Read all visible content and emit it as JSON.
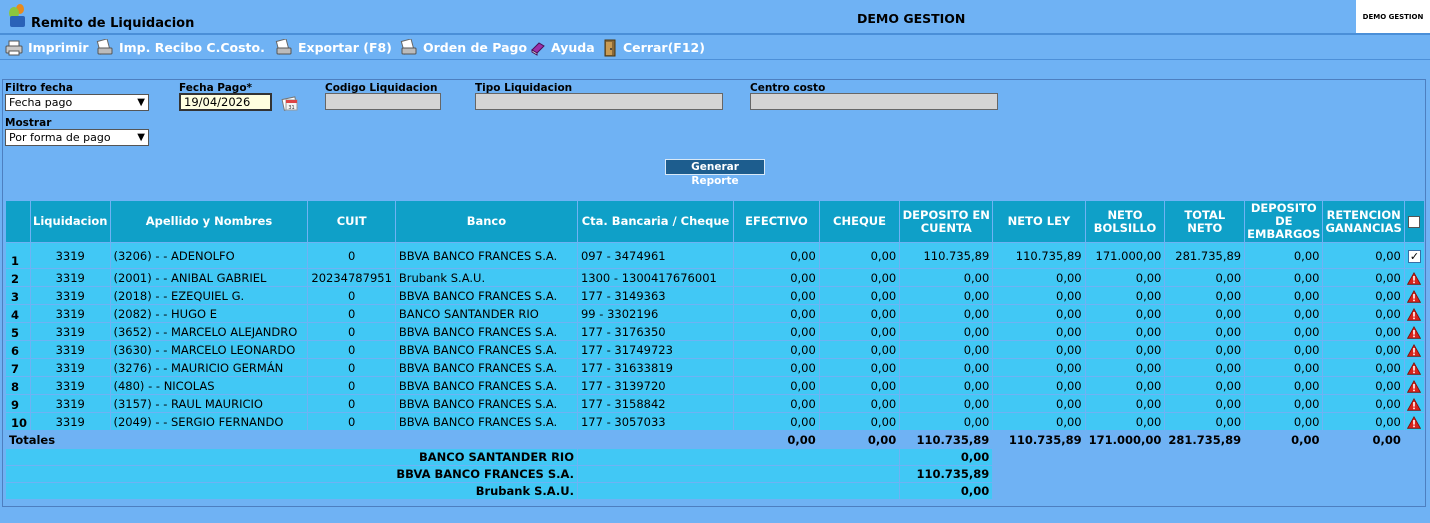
{
  "app": {
    "title": "Remito de Liquidacion",
    "company": "DEMO GESTION",
    "logo_text": "DEMO GESTION"
  },
  "toolbar": [
    {
      "label": "Imprimir",
      "icon": "printer-icon"
    },
    {
      "label": "Imp. Recibo C.Costo.",
      "icon": "print-receipt-icon"
    },
    {
      "label": "Exportar (F8)",
      "icon": "export-icon"
    },
    {
      "label": "Orden de Pago",
      "icon": "payment-order-icon"
    },
    {
      "label": "Ayuda",
      "icon": "help-book-icon"
    },
    {
      "label": "Cerrar(F12)",
      "icon": "close-door-icon"
    }
  ],
  "filters": {
    "filtro_fecha": {
      "label": "Filtro fecha",
      "value": "Fecha pago"
    },
    "fecha_pago": {
      "label": "Fecha Pago*",
      "value": "19/04/2026"
    },
    "codigo_liquidacion": {
      "label": "Codigo Liquidacion",
      "value": ""
    },
    "tipo_liquidacion": {
      "label": "Tipo Liquidacion",
      "value": ""
    },
    "centro_costo": {
      "label": "Centro costo",
      "value": ""
    },
    "mostrar": {
      "label": "Mostrar",
      "value": "Por forma de pago"
    }
  },
  "generate_button": "Generar Reporte",
  "table": {
    "headers": [
      "",
      "Liquidacion",
      "Apellido y Nombres",
      "CUIT",
      "Banco",
      "Cta. Bancaria / Cheque",
      "EFECTIVO",
      "CHEQUE",
      "DEPOSITO EN CUENTA",
      "NETO LEY",
      "NETO BOLSILLO",
      "TOTAL NETO",
      "DEPOSITO DE EMBARGOS",
      "RETENCION GANANCIAS"
    ],
    "rows": [
      {
        "n": "1",
        "liq": "3319",
        "nombre": "(3206) - - ADENOLFO",
        "cuit": "0",
        "banco": "BBVA BANCO FRANCES S.A.",
        "cta": "097 - 3474961",
        "efectivo": "0,00",
        "cheque": "0,00",
        "deposito": "110.735,89",
        "neto_ley": "110.735,89",
        "neto_bolsillo": "171.000,00",
        "total_neto": "281.735,89",
        "embargos": "0,00",
        "retencion": "0,00",
        "status": "checked"
      },
      {
        "n": "2",
        "liq": "3319",
        "nombre": "(2001) - - ANIBAL GABRIEL",
        "cuit": "20234787951",
        "banco": "Brubank S.A.U.",
        "cta": "1300 - 1300417676001",
        "efectivo": "0,00",
        "cheque": "0,00",
        "deposito": "0,00",
        "neto_ley": "0,00",
        "neto_bolsillo": "0,00",
        "total_neto": "0,00",
        "embargos": "0,00",
        "retencion": "0,00",
        "status": "warning"
      },
      {
        "n": "3",
        "liq": "3319",
        "nombre": "(2018) - - EZEQUIEL G.",
        "cuit": "0",
        "banco": "BBVA BANCO FRANCES S.A.",
        "cta": "177 - 3149363",
        "efectivo": "0,00",
        "cheque": "0,00",
        "deposito": "0,00",
        "neto_ley": "0,00",
        "neto_bolsillo": "0,00",
        "total_neto": "0,00",
        "embargos": "0,00",
        "retencion": "0,00",
        "status": "warning"
      },
      {
        "n": "4",
        "liq": "3319",
        "nombre": "(2082) - - HUGO E",
        "cuit": "0",
        "banco": "BANCO SANTANDER RIO",
        "cta": "99 - 3302196",
        "efectivo": "0,00",
        "cheque": "0,00",
        "deposito": "0,00",
        "neto_ley": "0,00",
        "neto_bolsillo": "0,00",
        "total_neto": "0,00",
        "embargos": "0,00",
        "retencion": "0,00",
        "status": "warning"
      },
      {
        "n": "5",
        "liq": "3319",
        "nombre": "(3652) - - MARCELO ALEJANDRO",
        "cuit": "0",
        "banco": "BBVA BANCO FRANCES S.A.",
        "cta": "177 - 3176350",
        "efectivo": "0,00",
        "cheque": "0,00",
        "deposito": "0,00",
        "neto_ley": "0,00",
        "neto_bolsillo": "0,00",
        "total_neto": "0,00",
        "embargos": "0,00",
        "retencion": "0,00",
        "status": "warning"
      },
      {
        "n": "6",
        "liq": "3319",
        "nombre": "(3630) - - MARCELO LEONARDO",
        "cuit": "0",
        "banco": "BBVA BANCO FRANCES S.A.",
        "cta": "177 - 31749723",
        "efectivo": "0,00",
        "cheque": "0,00",
        "deposito": "0,00",
        "neto_ley": "0,00",
        "neto_bolsillo": "0,00",
        "total_neto": "0,00",
        "embargos": "0,00",
        "retencion": "0,00",
        "status": "warning"
      },
      {
        "n": "7",
        "liq": "3319",
        "nombre": "(3276) - - MAURICIO GERMÁN",
        "cuit": "0",
        "banco": "BBVA BANCO FRANCES S.A.",
        "cta": "177 - 31633819",
        "efectivo": "0,00",
        "cheque": "0,00",
        "deposito": "0,00",
        "neto_ley": "0,00",
        "neto_bolsillo": "0,00",
        "total_neto": "0,00",
        "embargos": "0,00",
        "retencion": "0,00",
        "status": "warning"
      },
      {
        "n": "8",
        "liq": "3319",
        "nombre": "(480) - - NICOLAS",
        "cuit": "0",
        "banco": "BBVA BANCO FRANCES S.A.",
        "cta": "177 - 3139720",
        "efectivo": "0,00",
        "cheque": "0,00",
        "deposito": "0,00",
        "neto_ley": "0,00",
        "neto_bolsillo": "0,00",
        "total_neto": "0,00",
        "embargos": "0,00",
        "retencion": "0,00",
        "status": "warning"
      },
      {
        "n": "9",
        "liq": "3319",
        "nombre": "(3157) - - RAUL MAURICIO",
        "cuit": "0",
        "banco": "BBVA BANCO FRANCES S.A.",
        "cta": "177 - 3158842",
        "efectivo": "0,00",
        "cheque": "0,00",
        "deposito": "0,00",
        "neto_ley": "0,00",
        "neto_bolsillo": "0,00",
        "total_neto": "0,00",
        "embargos": "0,00",
        "retencion": "0,00",
        "status": "warning"
      },
      {
        "n": "10",
        "liq": "3319",
        "nombre": "(2049) - - SERGIO FERNANDO",
        "cuit": "0",
        "banco": "BBVA BANCO FRANCES S.A.",
        "cta": "177 - 3057033",
        "efectivo": "0,00",
        "cheque": "0,00",
        "deposito": "0,00",
        "neto_ley": "0,00",
        "neto_bolsillo": "0,00",
        "total_neto": "0,00",
        "embargos": "0,00",
        "retencion": "0,00",
        "status": "warning"
      }
    ],
    "totals": {
      "label": "Totales",
      "efectivo": "0,00",
      "cheque": "0,00",
      "deposito": "110.735,89",
      "neto_ley": "110.735,89",
      "neto_bolsillo": "171.000,00",
      "total_neto": "281.735,89",
      "embargos": "0,00",
      "retencion": "0,00"
    },
    "bank_totals": [
      {
        "banco": "BANCO SANTANDER RIO",
        "valor": "0,00"
      },
      {
        "banco": "BBVA BANCO FRANCES S.A.",
        "valor": "110.735,89"
      },
      {
        "banco": "Brubank S.A.U.",
        "valor": "0,00"
      }
    ]
  },
  "colors": {
    "background": "#6fb2f4",
    "header": "#0fa0c8",
    "row": "#41c8f5",
    "button": "#1d5d8e",
    "warning": "#d9241c"
  }
}
